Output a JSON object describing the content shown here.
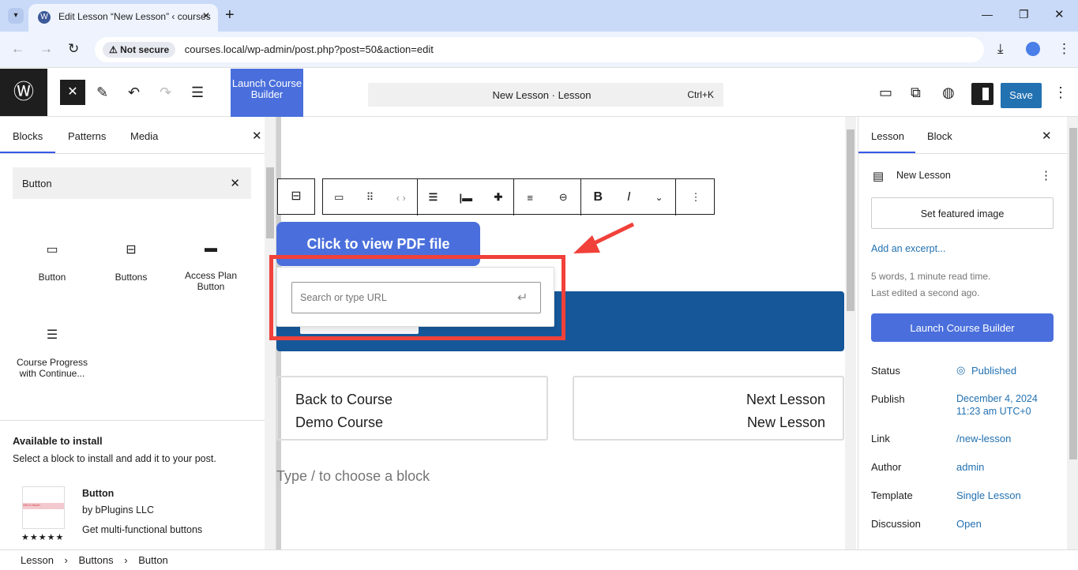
{
  "browser": {
    "tab_title": "Edit Lesson “New Lesson” ‹ courses",
    "security": "Not secure",
    "url": "courses.local/wp-admin/post.php?post=50&action=edit"
  },
  "header": {
    "launch_label": "Launch Course Builder",
    "command_title": "New Lesson · Lesson",
    "shortcut": "Ctrl+K",
    "save_label": "Save"
  },
  "inserter": {
    "tabs": [
      "Blocks",
      "Patterns",
      "Media"
    ],
    "search_value": "Button",
    "blocks": [
      {
        "label": "Button",
        "icon": "button-icon"
      },
      {
        "label": "Buttons",
        "icon": "buttons-icon"
      },
      {
        "label": "Access Plan Button",
        "icon": "button-filled-icon"
      },
      {
        "label": "Course Progress with Continue...",
        "icon": "progress-icon"
      }
    ],
    "install_title": "Available to install",
    "install_desc": "Select a block to install and add it to your post.",
    "plugin": {
      "name": "Button",
      "author": "by bPlugins LLC",
      "desc": "Get multi-functional buttons",
      "rating": 5,
      "stars": "★★★★★",
      "thumb_text": "Get in touch"
    }
  },
  "canvas": {
    "button_text": "Click to view PDF file",
    "url_placeholder": "Search or type URL",
    "back_label": "Back to Course",
    "back_course": "Demo Course",
    "next_label": "Next Lesson",
    "next_lesson": "New Lesson",
    "appender": "Type / to choose a block"
  },
  "sidebar": {
    "tabs": [
      "Lesson",
      "Block"
    ],
    "post_title": "New Lesson",
    "featured": "Set featured image",
    "excerpt": "Add an excerpt...",
    "stats": "5 words, 1 minute read time.",
    "edited": "Last edited a second ago.",
    "launch": "Launch Course Builder",
    "fields": [
      {
        "label": "Status",
        "value": "Published"
      },
      {
        "label": "Publish",
        "value": "December 4, 2024 11:23 am UTC+0"
      },
      {
        "label": "Link",
        "value": "/new-lesson"
      },
      {
        "label": "Author",
        "value": "admin"
      },
      {
        "label": "Template",
        "value": "Single Lesson"
      },
      {
        "label": "Discussion",
        "value": "Open"
      }
    ]
  },
  "breadcrumb": [
    "Lesson",
    "Buttons",
    "Button"
  ],
  "colors": {
    "accent": "#3858e9",
    "wp_blue": "#2271b1",
    "banner": "#155799",
    "annotation": "#f0413a"
  }
}
